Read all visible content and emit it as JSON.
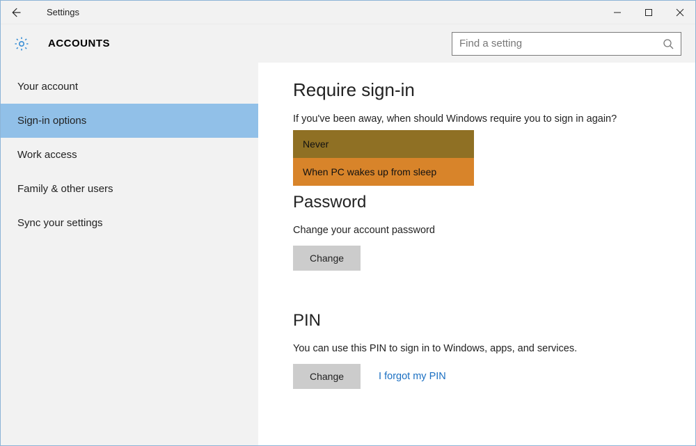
{
  "titlebar": {
    "title": "Settings"
  },
  "header": {
    "page": "ACCOUNTS",
    "search_placeholder": "Find a setting"
  },
  "sidebar": {
    "items": [
      {
        "label": "Your account",
        "selected": false
      },
      {
        "label": "Sign-in options",
        "selected": true
      },
      {
        "label": "Work access",
        "selected": false
      },
      {
        "label": "Family & other users",
        "selected": false
      },
      {
        "label": "Sync your settings",
        "selected": false
      }
    ]
  },
  "content": {
    "require_signin": {
      "heading": "Require sign-in",
      "desc": "If you've been away, when should Windows require you to sign in again?",
      "options": [
        {
          "label": "Never"
        },
        {
          "label": "When PC wakes up from sleep"
        }
      ]
    },
    "password": {
      "heading": "Password",
      "desc": "Change your account password",
      "button": "Change"
    },
    "pin": {
      "heading": "PIN",
      "desc": "You can use this PIN to sign in to Windows, apps, and services.",
      "button": "Change",
      "link": "I forgot my PIN"
    }
  }
}
